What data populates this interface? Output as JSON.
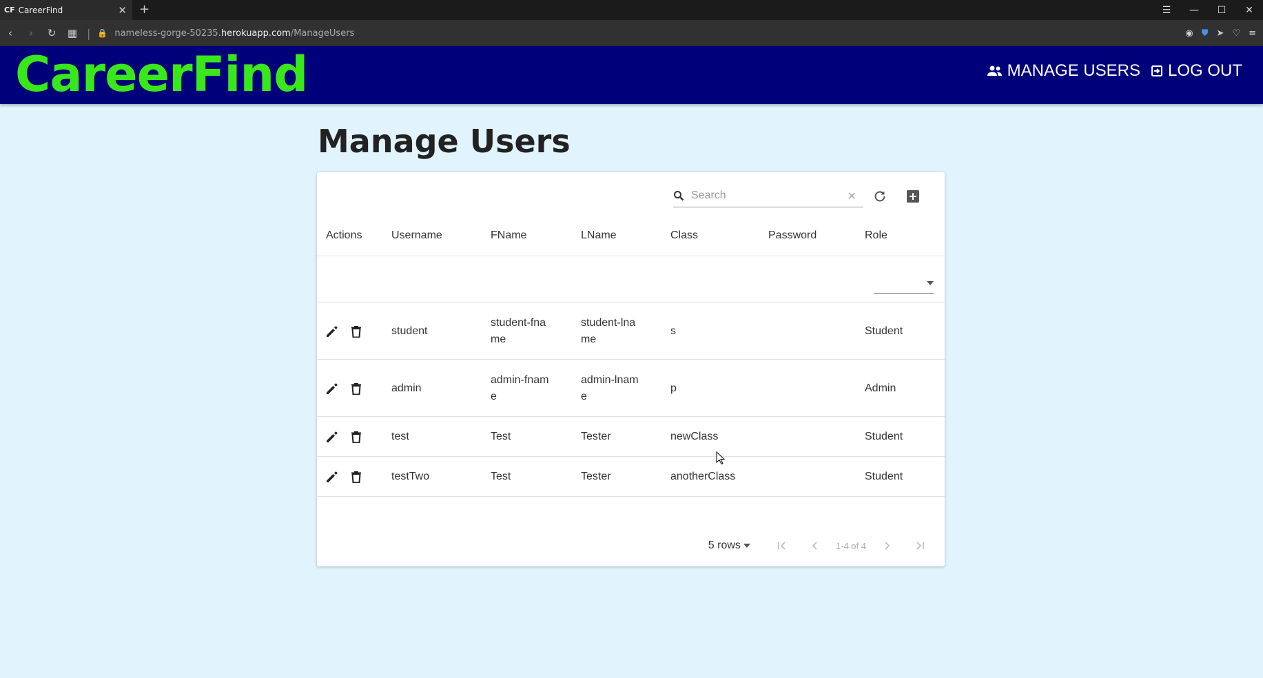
{
  "browser": {
    "tab_title": "CareerFind",
    "tab_favicon": "CF",
    "url_prefix": "nameless-gorge-50235.",
    "url_domain": "herokuapp.com",
    "url_path": "/ManageUsers"
  },
  "header": {
    "brand": "CareerFind",
    "nav": [
      {
        "label": "MANAGE USERS",
        "icon": "people-icon"
      },
      {
        "label": "LOG OUT",
        "icon": "logout-icon"
      }
    ],
    "colors": {
      "background": "#00007a",
      "brand": "#39e81a"
    }
  },
  "page": {
    "title": "Manage Users",
    "background": "#e1f4fd"
  },
  "table": {
    "search_placeholder": "Search",
    "columns": [
      "Actions",
      "Username",
      "FName",
      "LName",
      "Class",
      "Password",
      "Role"
    ],
    "rows": [
      {
        "username": "student",
        "fname": "student-fname",
        "lname": "student-lname",
        "class": "s",
        "password": "",
        "role": "Student"
      },
      {
        "username": "admin",
        "fname": "admin-fname",
        "lname": "admin-lname",
        "class": "p",
        "password": "",
        "role": "Admin"
      },
      {
        "username": "test",
        "fname": "Test",
        "lname": "Tester",
        "class": "newClass",
        "password": "",
        "role": "Student"
      },
      {
        "username": "testTwo",
        "fname": "Test",
        "lname": "Tester",
        "class": "anotherClass",
        "password": "",
        "role": "Student"
      }
    ],
    "pagination": {
      "rows_per_page": "5 rows",
      "range": "1-4 of 4"
    }
  }
}
